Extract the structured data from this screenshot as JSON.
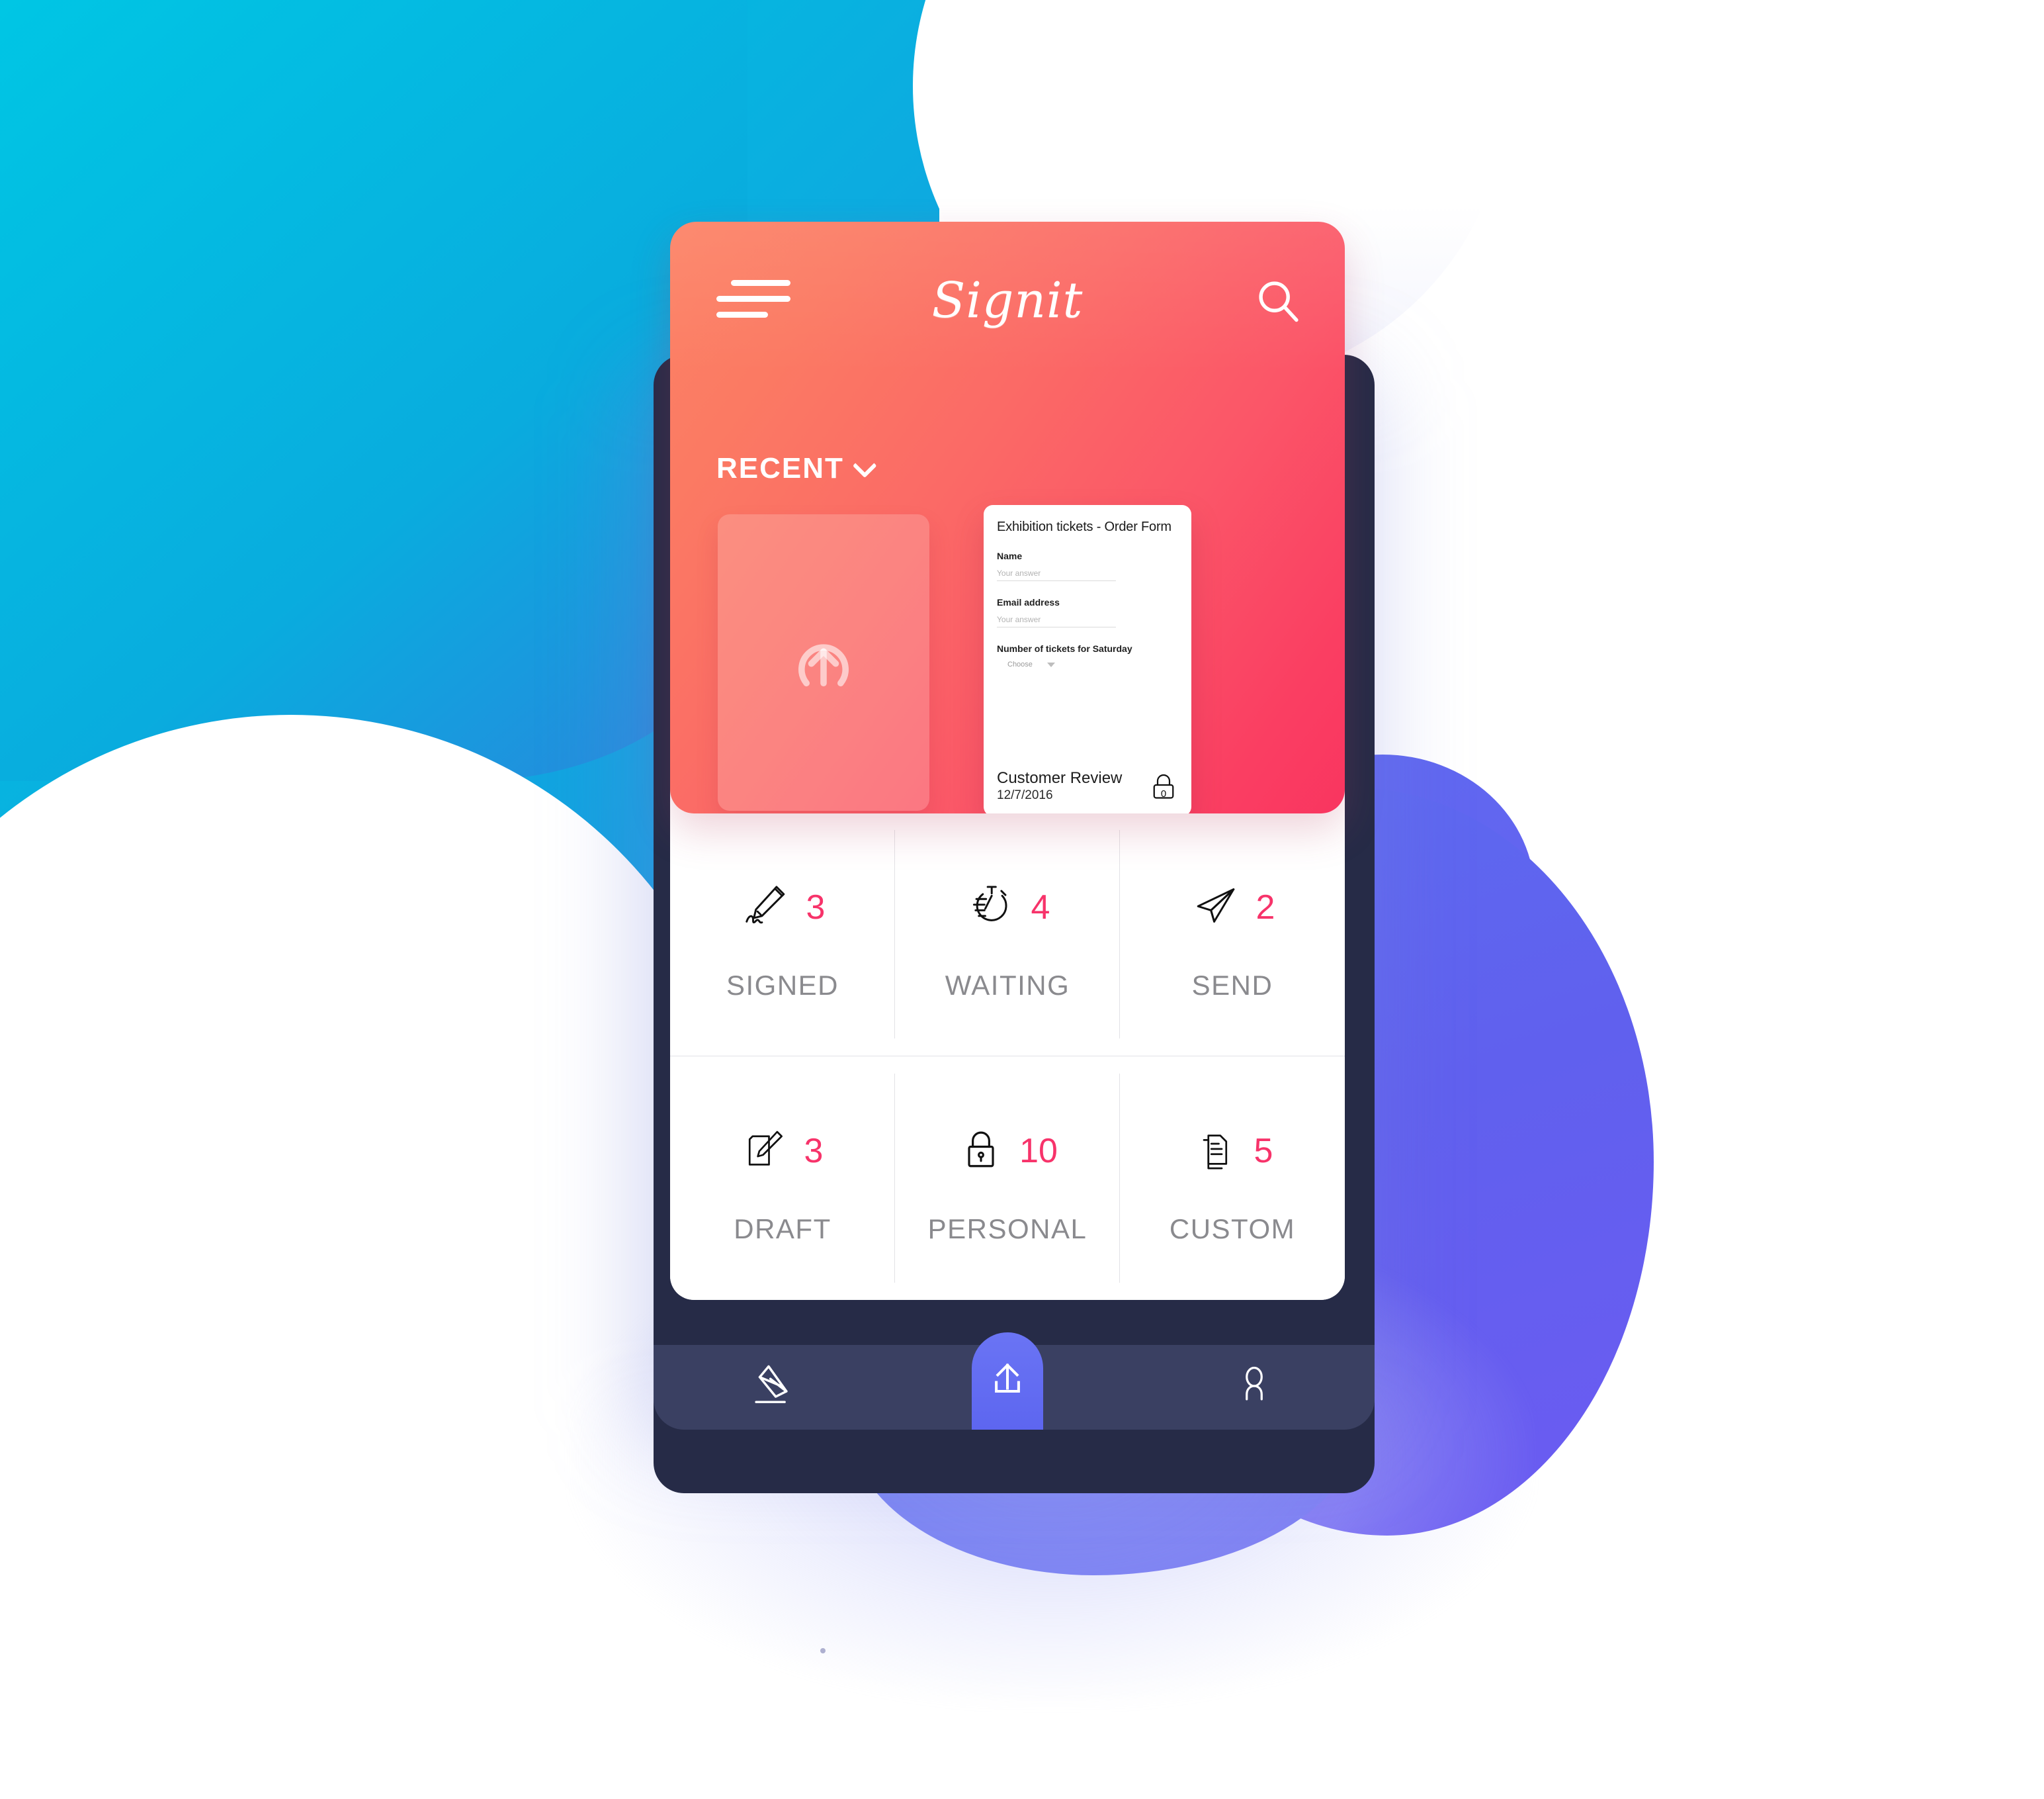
{
  "app": {
    "brand": "Signit",
    "accent_red": "#F7336A",
    "accent_purple": "#6A74F4",
    "header_gradient_from": "#FC8265",
    "header_gradient_to": "#F93560",
    "frame_color": "#262B47",
    "navbar_color": "#3A4062"
  },
  "header": {
    "menu_icon": "hamburger-icon",
    "search_icon": "search-icon",
    "section_label": "RECENT",
    "section_chevron_icon": "chevron-down-icon"
  },
  "recent": {
    "upload_tile": {
      "icon": "upload-circle-arrow-icon",
      "label": ""
    },
    "document": {
      "title": "Exhibition tickets - Order Form",
      "fields": [
        {
          "label": "Name",
          "placeholder": "Your answer",
          "value": ""
        },
        {
          "label": "Email address",
          "placeholder": "Your answer",
          "value": ""
        }
      ],
      "choice_field": {
        "label": "Number of tickets for Saturday",
        "selected": "Choose",
        "caret_icon": "caret-down-icon"
      },
      "footer_name": "Customer Review",
      "footer_date": "12/7/2016",
      "lock_icon": "lock-icon",
      "lock_badge_count": "0"
    }
  },
  "stats": [
    {
      "label": "SIGNED",
      "count": "3",
      "icon": "pen-signature-icon"
    },
    {
      "label": "WAITING",
      "count": "4",
      "icon": "stopwatch-icon"
    },
    {
      "label": "SEND",
      "count": "2",
      "icon": "paper-plane-icon"
    },
    {
      "label": "DRAFT",
      "count": "3",
      "icon": "document-pencil-icon"
    },
    {
      "label": "PERSONAL",
      "count": "10",
      "icon": "padlock-icon"
    },
    {
      "label": "CUSTOM",
      "count": "5",
      "icon": "documents-stack-icon"
    }
  ],
  "bottom_nav": {
    "items": [
      {
        "name": "sign",
        "icon": "fountain-pen-nib-icon",
        "active": false
      },
      {
        "name": "upload",
        "icon": "upload-arrow-icon",
        "active": true
      },
      {
        "name": "profile",
        "icon": "person-icon",
        "active": false
      }
    ]
  }
}
